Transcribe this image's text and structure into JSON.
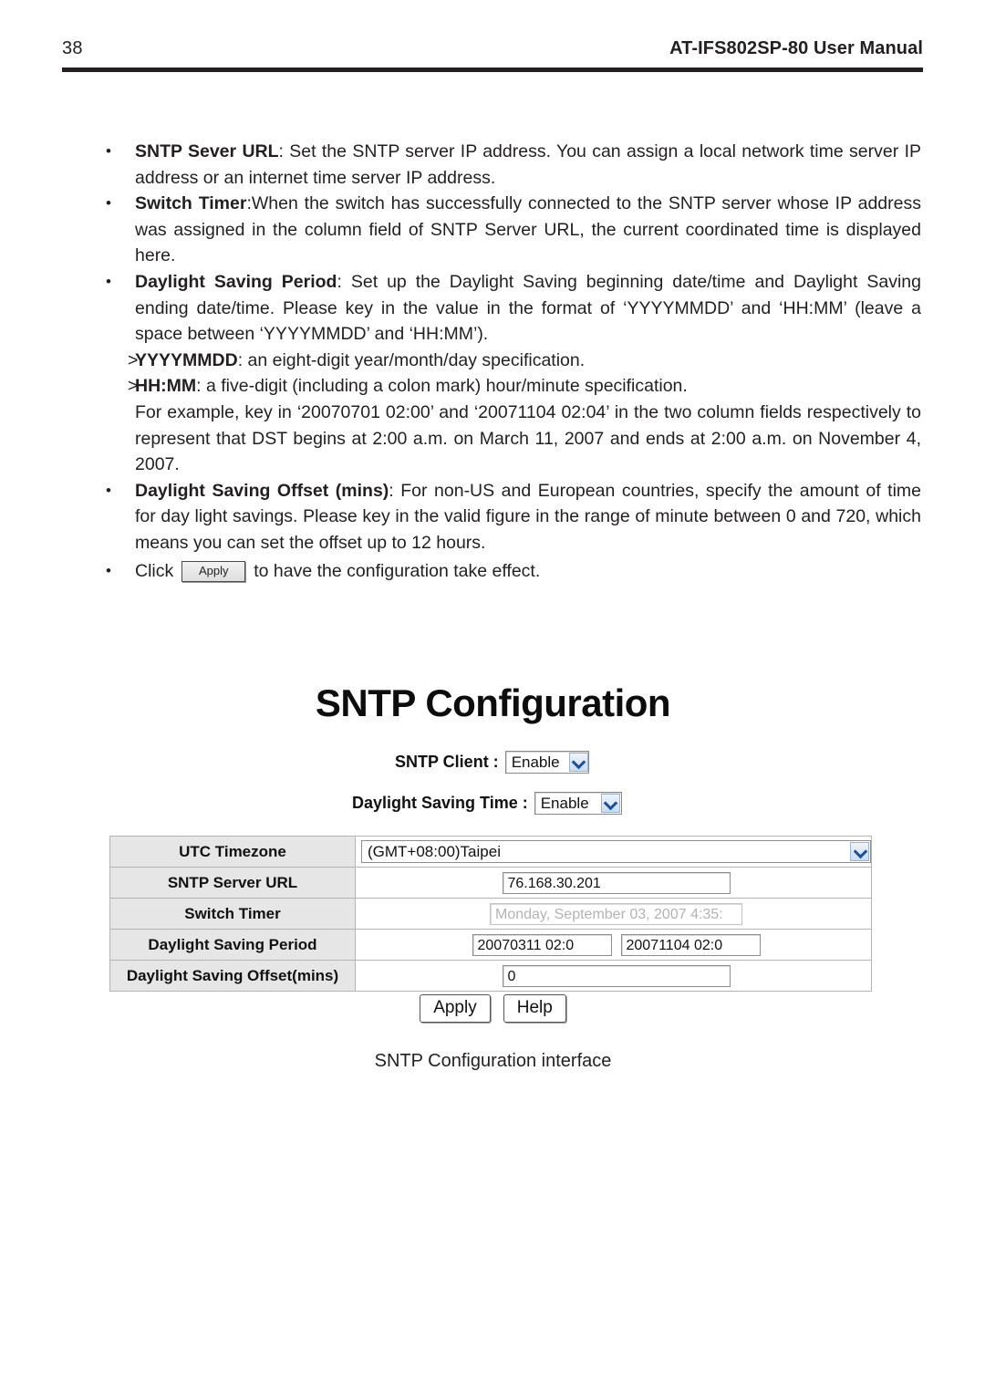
{
  "header": {
    "page_number": "38",
    "manual_title": "AT-IFS802SP-80 User Manual"
  },
  "body": {
    "bullets": [
      {
        "term": "SNTP Sever URL",
        "text": ": Set the SNTP server IP address. You can assign a local network time server IP address or an internet time server IP address."
      },
      {
        "term": "Switch Timer",
        "text": ":When the switch has successfully connected to the SNTP server whose IP address was assigned in the column field of SNTP Server URL, the current coordinated time is displayed here."
      },
      {
        "term": "Daylight Saving Period",
        "text": ": Set up the Daylight Saving beginning date/time and Daylight Saving ending date/time. Please key in the value in the format of ‘YYYYMMDD’ and ‘HH:MM’ (leave a space between ‘YYYYMMDD’ and ‘HH:MM’)."
      },
      {
        "term": "Daylight Saving Offset (mins)",
        "text": ": For non-US and European countries, specify the amount of time for day light savings. Please key in the valid figure in the range of minute between 0 and 720, which means you can set the offset up to 12 hours."
      }
    ],
    "sub_items": [
      {
        "marker": ">",
        "term": "YYYYMMDD",
        "text": ": an eight-digit year/month/day specification."
      },
      {
        "marker": ">",
        "term": "HH:MM",
        "text": ": a five-digit (including a colon mark) hour/minute specification."
      }
    ],
    "example_paragraph": "For example, key in ‘20070701 02:00’ and ‘20071104 02:04’ in the two column fields respectively to represent that DST begins at 2:00 a.m. on March 11, 2007 and ends at 2:00 a.m. on November 4, 2007.",
    "click_bullet": {
      "before": "Click",
      "button_label": "Apply",
      "after": "to have the configuration take effect."
    },
    "bullet_glyph": "•"
  },
  "screenshot": {
    "title": "SNTP Configuration",
    "sntp_client": {
      "label": "SNTP Client :",
      "value": "Enable"
    },
    "daylight_saving_time": {
      "label": "Daylight Saving Time :",
      "value": "Enable"
    },
    "table": [
      {
        "label": "UTC Timezone",
        "value": "(GMT+08:00)Taipei",
        "kind": "select"
      },
      {
        "label": "SNTP Server URL",
        "value": "76.168.30.201",
        "kind": "input"
      },
      {
        "label": "Switch Timer",
        "value": "Monday, September 03, 2007 4:35:",
        "kind": "readonly"
      },
      {
        "label": "Daylight Saving Period",
        "value": "20070311 02:0",
        "value2": "20071104 02:0",
        "kind": "input-pair"
      },
      {
        "label": "Daylight Saving Offset(mins)",
        "value": "0",
        "kind": "input"
      }
    ],
    "buttons": {
      "apply": "Apply",
      "help": "Help"
    }
  },
  "figure_caption": "SNTP Configuration interface"
}
